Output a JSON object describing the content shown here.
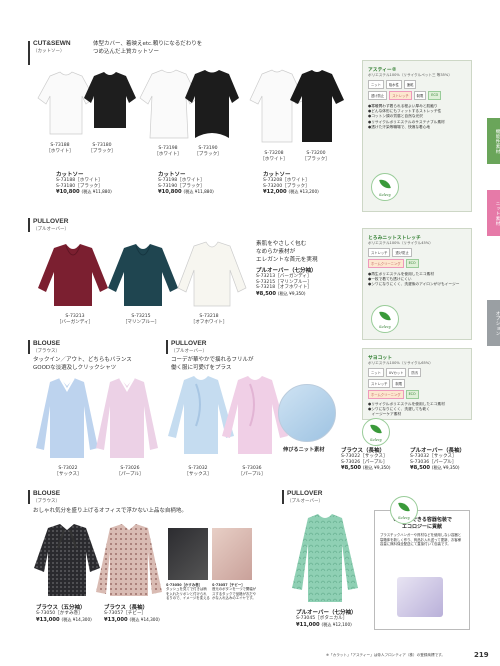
{
  "sections": {
    "cutsewn": {
      "en": "CUT&SEWN",
      "jp": "（カットソー）",
      "tagline1": "体型カバー、着映えetc.頼りになるだわりを",
      "tagline2": "つめ込んだ上質カットソー"
    },
    "pullover1": {
      "en": "PULLOVER",
      "jp": "（プルオーバー）"
    },
    "blouse1": {
      "en": "BLOUSE",
      "jp": "（ブラウス）",
      "tagline1": "タックイン／アウト、どちらもバランス",
      "tagline2": "GOODな淡選及しクリックシャツ"
    },
    "pullover2": {
      "en": "PULLOVER",
      "jp": "（プルオーバー）",
      "tagline1": "コーデが華やかで揺れるフリルが",
      "tagline2": "働く服に可愛げをプラス"
    },
    "blouse2": {
      "en": "BLOUSE",
      "jp": "（ブラウス）",
      "tagline": "おしゃれ気分を盛り上げるオフィスで浮かない上品な自柄地。"
    },
    "pullover3": {
      "en": "PULLOVER",
      "jp": "（プルオーバー）"
    }
  },
  "row1_codes": [
    {
      "code": "S-73188",
      "color": "［ホワイト］"
    },
    {
      "code": "S-73180",
      "color": "［ブラック］"
    },
    {
      "code": "S-73198",
      "color": "［ホワイト］"
    },
    {
      "code": "S-73190",
      "color": "［ブラック］"
    },
    {
      "code": "S-73208",
      "color": "［ホワイト］"
    },
    {
      "code": "S-73200",
      "color": "［ブラック］"
    }
  ],
  "row1_products": [
    {
      "name": "カットソー",
      "l1": "S-73188［ホワイト］",
      "l2": "S-73180［ブラック］",
      "price": "¥10,800",
      "tax": "(税込 ¥11,880)"
    },
    {
      "name": "カットソー",
      "l1": "S-73198［ホワイト］",
      "l2": "S-73190［ブラック］",
      "price": "¥10,800",
      "tax": "(税込 ¥11,880)"
    },
    {
      "name": "カットソー",
      "l1": "S-73208［ホワイト］",
      "l2": "S-73200［ブラック］",
      "price": "¥12,000",
      "tax": "(税込 ¥13,200)"
    }
  ],
  "material1": {
    "title": "アスティー®",
    "sub": "ポリエステル100%（リサイクルペット三 等35%）",
    "tabs": [
      "ニット",
      "吸水性",
      "速乾",
      "透け防止",
      "ストレッチ",
      "制電",
      "ECO"
    ],
    "features": [
      "●寒暖問わず着られる程よい厚みと肌触り",
      "●どんな体形にもフィットするストレッチ性",
      "●コットン調の質感と自然な光沢",
      "●リサイクルポリエステルのサステナブル素材",
      "●透けた汗染等職場で、快適な着心地"
    ]
  },
  "row2_codes": [
    {
      "code": "S-73213",
      "color": "［バーガンディ］"
    },
    {
      "code": "S-73215",
      "color": "［マリンブルー］"
    },
    {
      "code": "S-73218",
      "color": "［オフホワイト］"
    }
  ],
  "row2_copy": {
    "t1": "素肌をやさしく包む",
    "t2": "なめらか素材が",
    "t3": "エレガントな首元を実現",
    "name": "プルオーバー（七分袖）",
    "l1": "S-73213［バーガンディ］",
    "l2": "S-73215［マリンブルー］",
    "l3": "S-73218［オフホワイト］",
    "price": "¥8,500",
    "tax": "(税込 ¥9,350)"
  },
  "material2": {
    "title": "とろみニットストレッチ",
    "sub": "ポリエステル100%（リサイクル45%）",
    "tabs": [
      "ストレッチ",
      "透け防止",
      "ホームクリーニング",
      "ECO"
    ],
    "features": [
      "●再生ポリエステルを使用したエコ素材",
      "●一枚で着ても透けにくい",
      "●シワになりにくく、洗濯後のアイロンがけもイージー"
    ]
  },
  "row3_codes": [
    {
      "code": "S-73022",
      "color": "［サックス］"
    },
    {
      "code": "S-73026",
      "color": "［パープル］"
    },
    {
      "code": "S-73032",
      "color": "［サックス］"
    },
    {
      "code": "S-73036",
      "color": "［パープル］"
    }
  ],
  "knit_label": "伸びるニット素材",
  "material3": {
    "title": "サヨコット",
    "sub": "ポリエステル100%（リサイクル65%）",
    "tabs": [
      "ニット",
      "UVカット",
      "防汚",
      "ストレッチ",
      "制電",
      "ホームクリーニング",
      "ECO"
    ],
    "features": [
      "●リサイクルポリエステルを使用したエコ素材",
      "●シワになりにくく、洗濯しても乾く",
      "　イージーケア素材"
    ]
  },
  "row3_products": [
    {
      "name": "ブラウス（長袖）",
      "l1": "S-73022［サックス］",
      "l2": "S-73026［パープル］",
      "price": "¥8,500",
      "tax": "(税込 ¥9,350)"
    },
    {
      "name": "プルオーバー（長袖）",
      "l1": "S-73032［サックス］",
      "l2": "S-73036［パープル］",
      "price": "¥8,500",
      "tax": "(税込 ¥9,350)"
    }
  ],
  "row4_products": [
    {
      "name": "ブラウス（五分袖）",
      "l1": "S-73050［かすみ巻］",
      "price": "¥13,000",
      "tax": "(税込 ¥14,300)"
    },
    {
      "name": "ブラウス（長袖）",
      "l1": "S-73057［チビー］",
      "price": "¥13,000",
      "tax": "(税込 ¥14,300)"
    },
    {
      "name": "プルオーバー（七分袖）",
      "l1": "S-73045［ボタニカル］",
      "price": "¥11,000",
      "tax": "(税込 ¥12,100)"
    }
  ],
  "detail1": {
    "code": "S-73050［かすみ巻］",
    "text": "タッシュを見てで付きは柄を入れたリボンと付けられるりので、イメージを変える"
  },
  "detail2": {
    "code": "S-73057［チビー］",
    "text": "首元のボタンを一つで開幅がスするタックで品格がおだやかな入れ込みのエイヤです。"
  },
  "eco_box": {
    "title1": "リユースできる容器包装で",
    "title2": "エコロジーに貢献",
    "body": "プラスチックハンガーや資材などを使用しない容器と袋箱体を新しく作り、商品お入れ送って更新、お客様容量に無料保全配送にて直接付いて包装です。"
  },
  "footnote": "※「カラット」「アスティー」は帝人フロンティア（株）の登録商標です。",
  "page_number": "219",
  "sidetabs": [
    "機能性素材",
    "ニット素材",
    "オプション"
  ],
  "logo_text": "Selecy",
  "colors": {
    "pink": "#e67aa8",
    "green": "#6aa55a",
    "gray": "#9a9fa3",
    "accent": "#c33"
  }
}
